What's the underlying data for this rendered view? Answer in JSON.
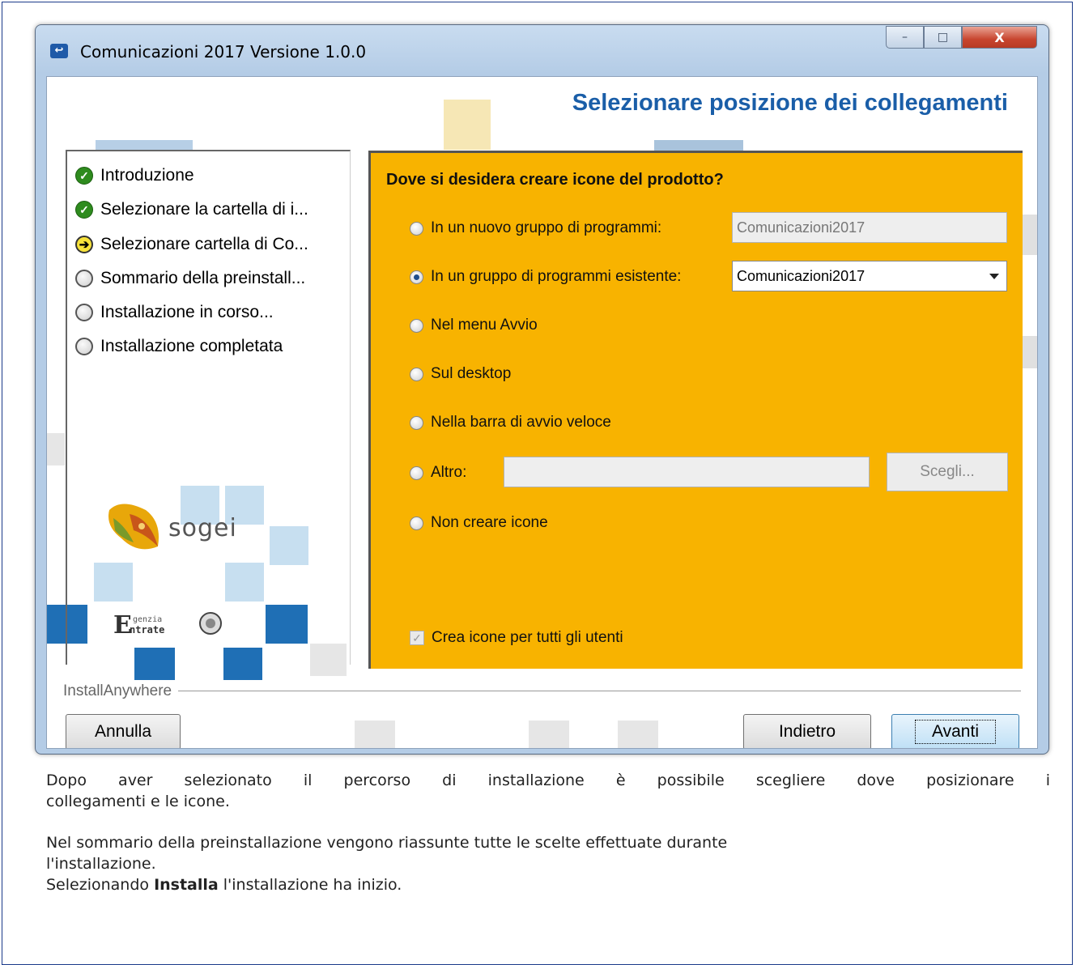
{
  "window": {
    "title": "Comunicazioni 2017 Versione 1.0.0",
    "controls": {
      "minimize": "–",
      "maximize": "□",
      "close": "X"
    }
  },
  "page": {
    "heading": "Selezionare posizione dei collegamenti"
  },
  "steps": [
    {
      "label": "Introduzione",
      "state": "done"
    },
    {
      "label": "Selezionare la cartella di i...",
      "state": "done"
    },
    {
      "label": "Selezionare cartella di Co...",
      "state": "current"
    },
    {
      "label": "Sommario della preinstall...",
      "state": "todo"
    },
    {
      "label": "Installazione in corso...",
      "state": "todo"
    },
    {
      "label": "Installazione completata",
      "state": "todo"
    }
  ],
  "logos": {
    "sogei": "sogei",
    "agenzia": "Agenzia Entrate"
  },
  "form": {
    "question": "Dove si desidera creare icone del prodotto?",
    "options": [
      {
        "label": "In un nuovo gruppo di programmi:",
        "selected": false,
        "field_value": "Comunicazioni2017",
        "field_state": "disabled"
      },
      {
        "label": "In un gruppo di programmi esistente:",
        "selected": true,
        "field_value": "Comunicazioni2017",
        "field_state": "dropdown"
      },
      {
        "label": "Nel menu Avvio",
        "selected": false
      },
      {
        "label": "Sul desktop",
        "selected": false
      },
      {
        "label": "Nella barra di avvio veloce",
        "selected": false
      },
      {
        "label": "Altro:",
        "selected": false,
        "field_value": "",
        "field_state": "disabled"
      },
      {
        "label": "Non creare icone",
        "selected": false
      }
    ],
    "choose_button": "Scegli...",
    "all_users_checkbox": {
      "label": "Crea icone per tutti gli utenti",
      "checked": true,
      "disabled": true
    }
  },
  "footer": {
    "brand": "InstallAnywhere",
    "cancel": "Annulla",
    "back": "Indietro",
    "next": "Avanti"
  },
  "description": {
    "p1": "Dopo aver selezionato il percorso di installazione è possibile scegliere dove posizionare i collegamenti e le icone.",
    "p1_line1": "Dopo aver selezionato il percorso di installazione è possibile scegliere dove posizionare i",
    "p1_line2": "collegamenti e le icone.",
    "p2_line1": "Nel sommario della preinstallazione vengono riassunte tutte le scelte effettuate durante",
    "p2_line2": "l'installazione.",
    "p3_prefix": "Selezionando",
    "p3_bold": "Installa",
    "p3_suffix": "l'installazione ha inizio."
  },
  "colors": {
    "panel": "#f8b300",
    "heading": "#1a5ea8",
    "accent_blue": "#1f6fb5",
    "light_blue": "#c7dff0"
  }
}
